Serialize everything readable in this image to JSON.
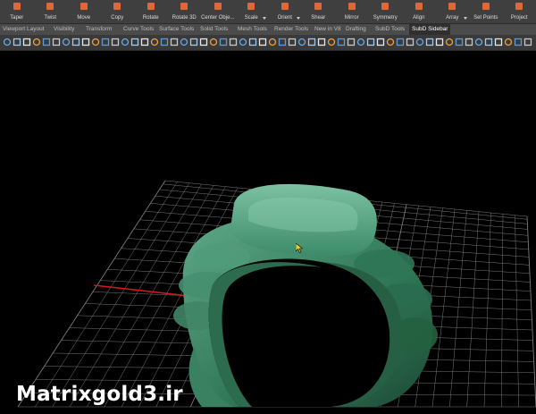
{
  "toolbar": {
    "commands": [
      {
        "label": "Taper",
        "dropdown": false
      },
      {
        "label": "Twist",
        "dropdown": false
      },
      {
        "label": "Move",
        "dropdown": false
      },
      {
        "label": "Copy",
        "dropdown": false
      },
      {
        "label": "Rotate",
        "dropdown": false
      },
      {
        "label": "Rotate 3D",
        "dropdown": false
      },
      {
        "label": "Center Obje...",
        "dropdown": false
      },
      {
        "label": "Scale",
        "dropdown": true
      },
      {
        "label": "Orient",
        "dropdown": true
      },
      {
        "label": "Shear",
        "dropdown": false
      },
      {
        "label": "Mirror",
        "dropdown": false
      },
      {
        "label": "Symmetry",
        "dropdown": false
      },
      {
        "label": "Align",
        "dropdown": false
      },
      {
        "label": "Array",
        "dropdown": true
      },
      {
        "label": "Set Points",
        "dropdown": false
      },
      {
        "label": "Project",
        "dropdown": false
      }
    ]
  },
  "tabs": [
    {
      "label": "Viewport Layout",
      "active": false
    },
    {
      "label": "Visibility",
      "active": false
    },
    {
      "label": "Transform",
      "active": false
    },
    {
      "label": "Curve Tools",
      "active": false
    },
    {
      "label": "Surface Tools",
      "active": false
    },
    {
      "label": "Solid Tools",
      "active": false
    },
    {
      "label": "Mesh Tools",
      "active": false
    },
    {
      "label": "Render Tools",
      "active": false
    },
    {
      "label": "New in V8",
      "active": false
    },
    {
      "label": "Drafting",
      "active": false
    },
    {
      "label": "SubD Tools",
      "active": false
    },
    {
      "label": "SubD Sidebar",
      "active": true
    }
  ],
  "icon_row_count": 54,
  "watermark": "Matrixgold3.ir",
  "colors": {
    "accent_icon": "#e0673a",
    "ring": "#3e8c6a",
    "x_axis": "#d01818",
    "y_axis": "#1f9a3a",
    "grid": "#7a7a7a"
  }
}
